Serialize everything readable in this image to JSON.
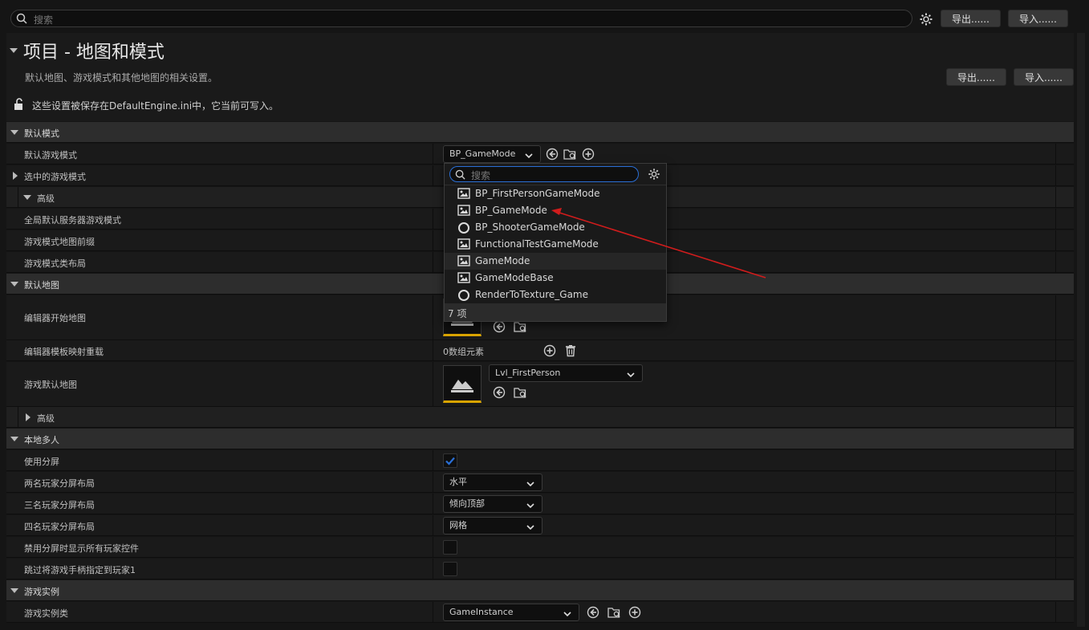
{
  "topbar": {
    "search_placeholder": "搜索",
    "export_label": "导出......",
    "import_label": "导入......"
  },
  "header": {
    "title": "项目 - 地图和模式",
    "description": "默认地图、游戏模式和其他地图的相关设置。",
    "export_label": "导出......",
    "import_label": "导入......",
    "config_note": "这些设置被保存在DefaultEngine.ini中，它当前可写入。"
  },
  "sections": {
    "default_modes": "默认模式",
    "default_maps": "默认地图",
    "local_multiplayer": "本地多人",
    "game_instance": "游戏实例"
  },
  "rows": {
    "default_game_mode": "默认游戏模式",
    "selected_game_mode": "选中的游戏模式",
    "advanced": "高级",
    "global_server_mode": "全局默认服务器游戏模式",
    "map_prefixes": "游戏模式地图前缀",
    "class_aliases": "游戏模式类布局",
    "editor_start_map": "编辑器开始地图",
    "editor_template_overrides": "编辑器模板映射重载",
    "game_default_map": "游戏默认地图",
    "advanced2": "高级",
    "use_splitscreen": "使用分屏",
    "two_player_layout": "两名玩家分屏布局",
    "three_player_layout": "三名玩家分屏布局",
    "four_player_layout": "四名玩家分屏布局",
    "skip_controllers": "禁用分屏时显示所有玩家控件",
    "skip_assign_gamepad": "跳过将游戏手柄指定到玩家1",
    "game_instance_class": "游戏实例类"
  },
  "values": {
    "game_mode_combo": "BP_GameMode",
    "array_count": "0数组元素",
    "game_default_map": "Lvl_FirstPerson",
    "two_player": "水平",
    "three_player": "倾向顶部",
    "four_player": "网格",
    "game_instance": "GameInstance",
    "use_splitscreen": true
  },
  "popup": {
    "search_placeholder": "搜索",
    "items": [
      {
        "label": "BP_FirstPersonGameMode",
        "icon": "blueprint-icon"
      },
      {
        "label": "BP_GameMode",
        "icon": "blueprint-icon"
      },
      {
        "label": "BP_ShooterGameMode",
        "icon": "class-circle-icon"
      },
      {
        "label": "FunctionalTestGameMode",
        "icon": "blueprint-icon"
      },
      {
        "label": "GameMode",
        "icon": "blueprint-icon"
      },
      {
        "label": "GameModeBase",
        "icon": "blueprint-icon"
      },
      {
        "label": "RenderToTexture_Game",
        "icon": "class-circle-icon"
      }
    ],
    "count_label": "7 项"
  },
  "colors": {
    "accent_blue": "#2a6fd6",
    "annotation_red": "#d01c1c",
    "thumb_underline": "#d9a400"
  }
}
